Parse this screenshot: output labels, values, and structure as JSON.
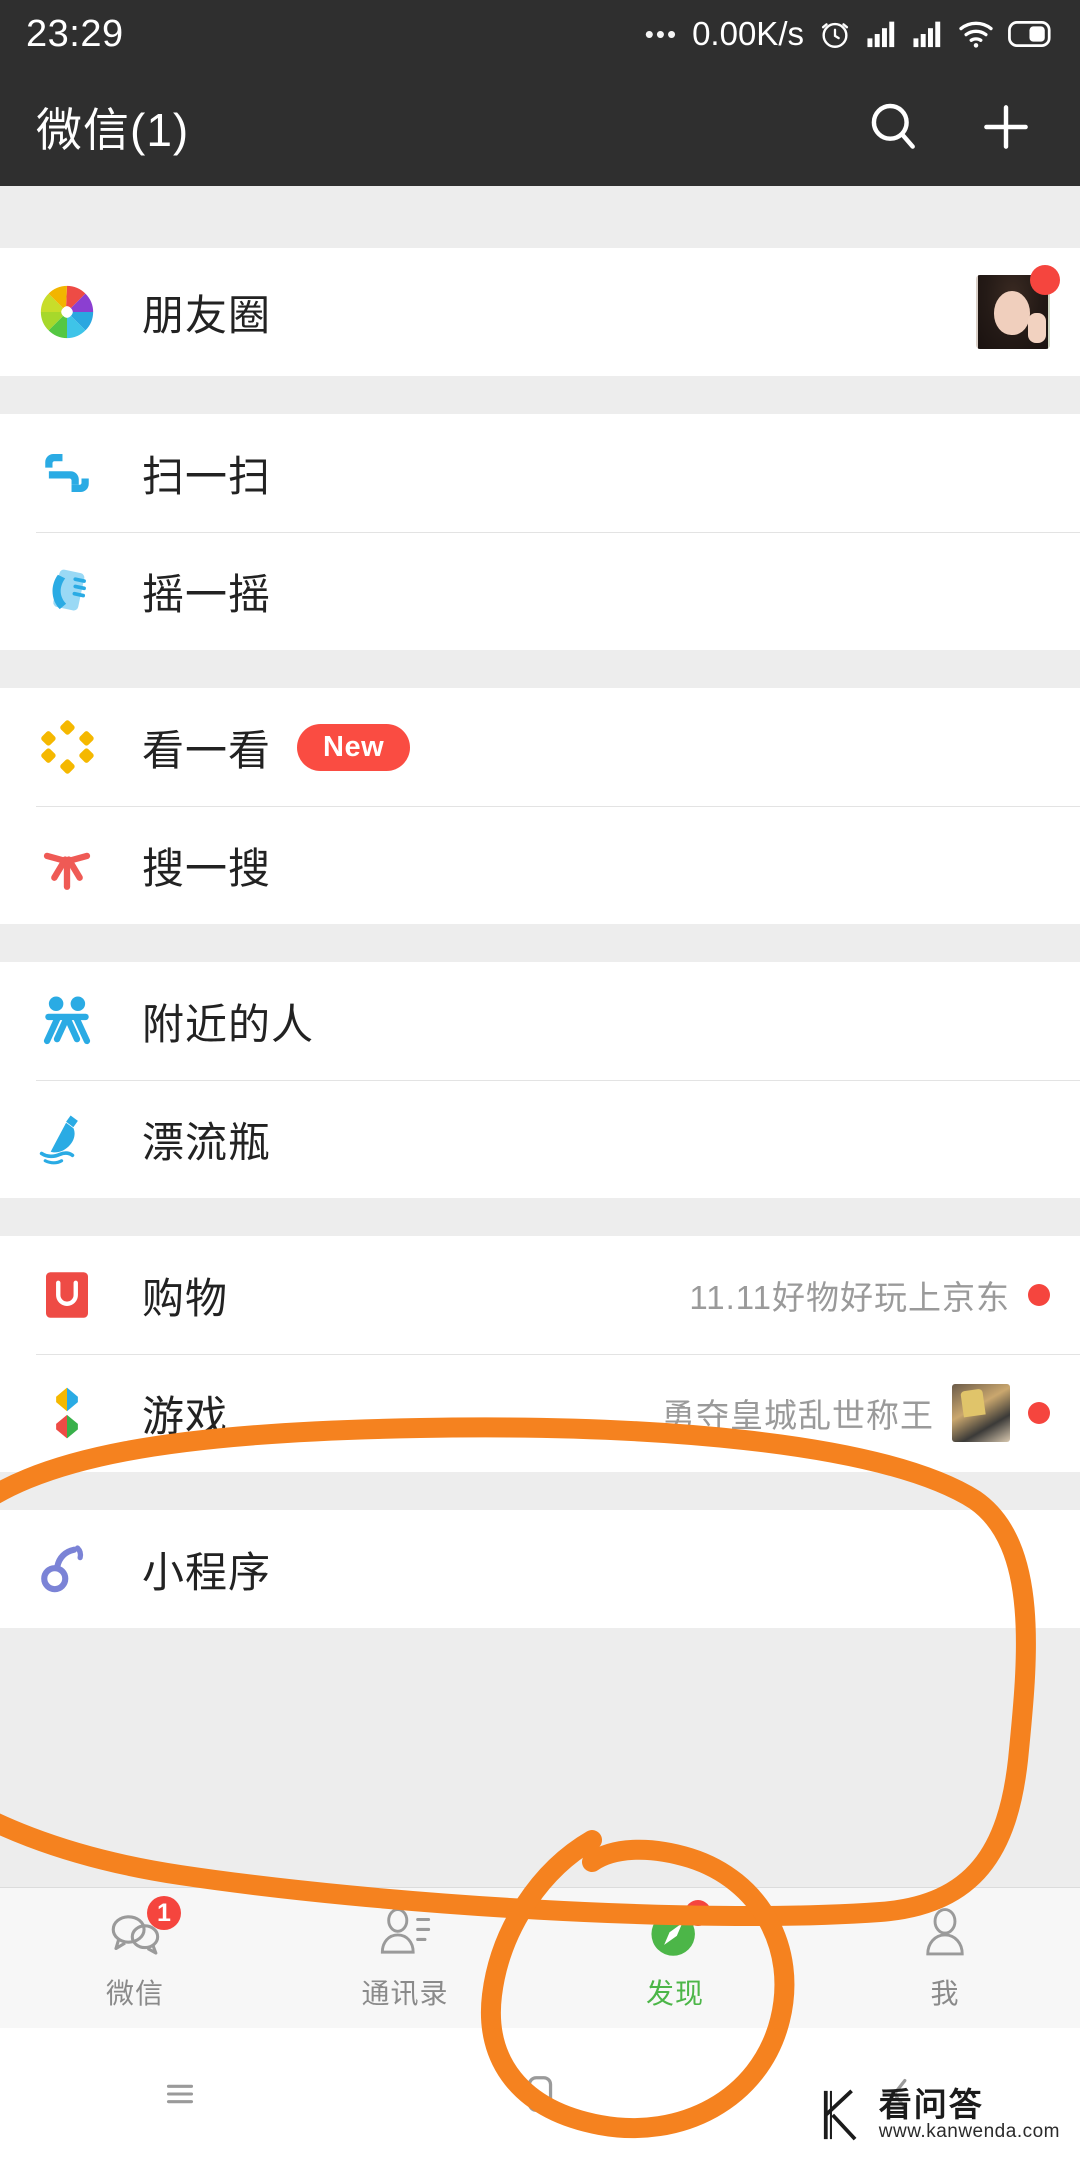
{
  "status_bar": {
    "time": "23:29",
    "dots": "•••",
    "net_speed": "0.00K/s",
    "icons": [
      "alarm-clock-icon",
      "signal-bars-icon",
      "signal-bars-icon",
      "wifi-icon",
      "battery-icon"
    ]
  },
  "title_bar": {
    "title": "微信(1)",
    "search_icon": "search-icon",
    "add_icon": "plus-icon"
  },
  "sections": [
    {
      "rows": [
        {
          "label": "朋友圈",
          "icon": "moments-aperture-icon",
          "avatar": true,
          "avatar_dot": true
        }
      ]
    },
    {
      "rows": [
        {
          "label": "扫一扫",
          "icon": "scan-icon"
        },
        {
          "label": "摇一摇",
          "icon": "shake-icon"
        }
      ]
    },
    {
      "rows": [
        {
          "label": "看一看",
          "icon": "top-stories-icon",
          "badge": "New"
        },
        {
          "label": "搜一搜",
          "icon": "search-star-icon"
        }
      ]
    },
    {
      "rows": [
        {
          "label": "附近的人",
          "icon": "people-nearby-icon"
        },
        {
          "label": "漂流瓶",
          "icon": "drift-bottle-icon"
        }
      ]
    },
    {
      "rows": [
        {
          "label": "购物",
          "icon": "shopping-bag-icon",
          "subtitle": "11.11好物好玩上京东",
          "dot": true
        },
        {
          "label": "游戏",
          "icon": "games-diamond-icon",
          "subtitle": "勇夺皇城乱世称王",
          "thumb": true,
          "dot": true
        }
      ]
    },
    {
      "rows": [
        {
          "label": "小程序",
          "icon": "mini-program-icon"
        }
      ]
    }
  ],
  "tab_bar": {
    "tabs": [
      {
        "label": "微信",
        "icon": "chat-bubble-icon",
        "badge": "1",
        "active": false
      },
      {
        "label": "通讯录",
        "icon": "contacts-icon",
        "active": false
      },
      {
        "label": "发现",
        "icon": "compass-icon",
        "dot": true,
        "active": true
      },
      {
        "label": "我",
        "icon": "person-icon",
        "active": false
      }
    ]
  },
  "nav_bar": {
    "menu_icon": "menu-icon",
    "home_icon": "home-square-icon",
    "back_icon": "back-chevron-icon"
  },
  "watermark": {
    "name": "看问答",
    "url": "www.kanwenda.com"
  },
  "annotations": {
    "color": "#f5821f",
    "shapes": [
      "big-oval-around-shopping-games-miniprogram",
      "small-oval-around-discover-tab"
    ]
  }
}
